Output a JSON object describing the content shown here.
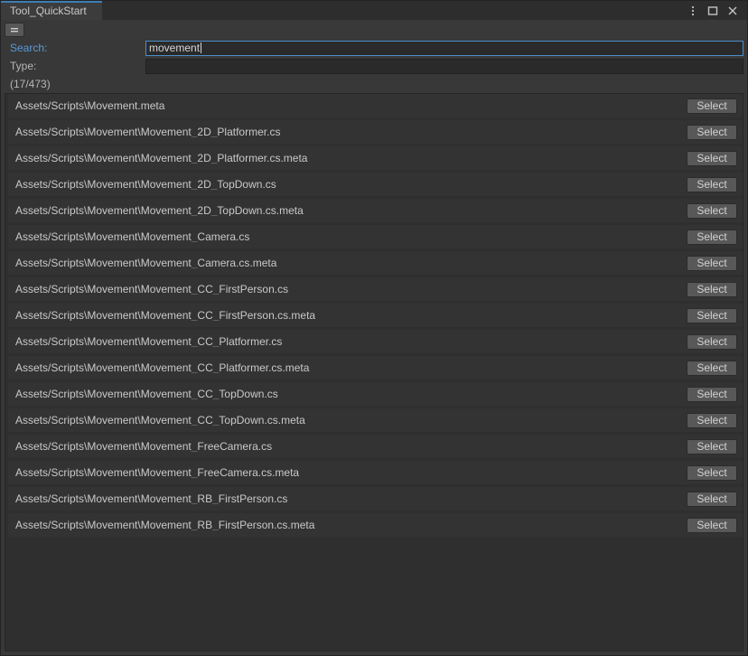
{
  "window": {
    "tab_label": "Tool_QuickStart",
    "controls": [
      {
        "name": "more-options",
        "glyph": "kebab"
      },
      {
        "name": "maximize",
        "glyph": "square"
      },
      {
        "name": "close",
        "glyph": "x"
      }
    ],
    "accent_color": "#3d7eb5"
  },
  "toolbar": {
    "menu_button_label": "="
  },
  "fields": {
    "search_label": "Search:",
    "search_value": "movement",
    "search_placeholder": "",
    "type_label": "Type:",
    "type_value": "",
    "type_placeholder": "",
    "count_text": "(17/473)"
  },
  "results": {
    "select_label": "Select",
    "items": [
      {
        "path": "Assets/Scripts\\Movement.meta"
      },
      {
        "path": "Assets/Scripts\\Movement\\Movement_2D_Platformer.cs"
      },
      {
        "path": "Assets/Scripts\\Movement\\Movement_2D_Platformer.cs.meta"
      },
      {
        "path": "Assets/Scripts\\Movement\\Movement_2D_TopDown.cs"
      },
      {
        "path": "Assets/Scripts\\Movement\\Movement_2D_TopDown.cs.meta"
      },
      {
        "path": "Assets/Scripts\\Movement\\Movement_Camera.cs"
      },
      {
        "path": "Assets/Scripts\\Movement\\Movement_Camera.cs.meta"
      },
      {
        "path": "Assets/Scripts\\Movement\\Movement_CC_FirstPerson.cs"
      },
      {
        "path": "Assets/Scripts\\Movement\\Movement_CC_FirstPerson.cs.meta"
      },
      {
        "path": "Assets/Scripts\\Movement\\Movement_CC_Platformer.cs"
      },
      {
        "path": "Assets/Scripts\\Movement\\Movement_CC_Platformer.cs.meta"
      },
      {
        "path": "Assets/Scripts\\Movement\\Movement_CC_TopDown.cs"
      },
      {
        "path": "Assets/Scripts\\Movement\\Movement_CC_TopDown.cs.meta"
      },
      {
        "path": "Assets/Scripts\\Movement\\Movement_FreeCamera.cs"
      },
      {
        "path": "Assets/Scripts\\Movement\\Movement_FreeCamera.cs.meta"
      },
      {
        "path": "Assets/Scripts\\Movement\\Movement_RB_FirstPerson.cs"
      },
      {
        "path": "Assets/Scripts\\Movement\\Movement_RB_FirstPerson.cs.meta"
      }
    ]
  }
}
